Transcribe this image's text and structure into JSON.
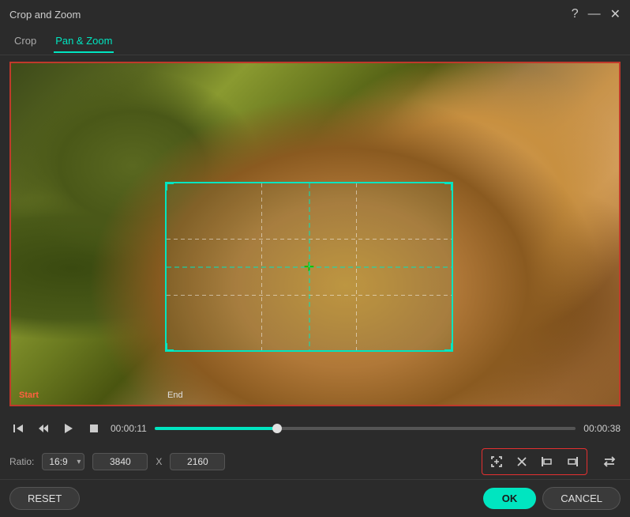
{
  "window": {
    "title": "Crop and Zoom"
  },
  "tabs": {
    "crop": "Crop",
    "pan_zoom": "Pan & Zoom"
  },
  "video": {
    "start_label": "Start",
    "end_label": "End",
    "time_current": "00:00:11",
    "time_total": "00:00:38",
    "progress_pct": 29
  },
  "controls": {
    "ratio_label": "Ratio:",
    "ratio_value": "16:9",
    "width": "3840",
    "separator": "X",
    "height": "2160"
  },
  "buttons": {
    "reset": "RESET",
    "ok": "OK",
    "cancel": "CANCEL"
  },
  "icons": {
    "help": "?",
    "minimize": "—",
    "close": "✕",
    "step_back": "⏮",
    "frame_back": "⏪",
    "play": "▶",
    "stop": "⏹",
    "crop_full": "⛶",
    "crop_custom": "✕",
    "align_left": "⊣",
    "align_right": "⊢",
    "swap": "⇄"
  }
}
